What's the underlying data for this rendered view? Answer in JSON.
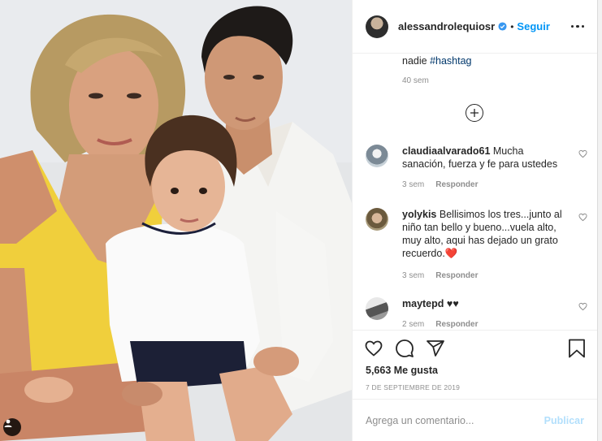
{
  "post": {
    "tag_icon": "person-tag-icon"
  },
  "header": {
    "username": "alessandrolequiosr",
    "verified_icon": "verified-badge-icon",
    "separator": "•",
    "follow_label": "Seguir",
    "more_icon": "more-options-icon"
  },
  "caption": {
    "text_start": "nadie ",
    "hashtag": "#hashtag",
    "time": "40 sem",
    "load_more_icon": "plus-circle-icon"
  },
  "comments": [
    {
      "username": "claudiaalvarado61",
      "text": "Mucha sanación, fuerza y fe para ustedes",
      "time": "3 sem",
      "reply_label": "Responder"
    },
    {
      "username": "yolykis",
      "text": "Bellisimos los tres...junto al niño tan bello y bueno...vuela alto, muy alto, aqui has dejado un grato recuerdo.",
      "emoji": "❤️",
      "time": "3 sem",
      "reply_label": "Responder"
    },
    {
      "username": "maytepd",
      "text": "♥♥",
      "time": "2 sem",
      "reply_label": "Responder"
    }
  ],
  "actions": {
    "like_icon": "heart-icon",
    "comment_icon": "comment-icon",
    "share_icon": "share-icon",
    "save_icon": "bookmark-icon",
    "likes": "5,663 Me gusta",
    "date": "7 DE SEPTIEMBRE DE 2019"
  },
  "composer": {
    "placeholder": "Agrega un comentario...",
    "post_label": "Publicar"
  },
  "colors": {
    "accent": "#0095f6",
    "post_disabled": "#b2dffc",
    "hashtag": "#00376b",
    "muted": "#8e8e8e"
  }
}
